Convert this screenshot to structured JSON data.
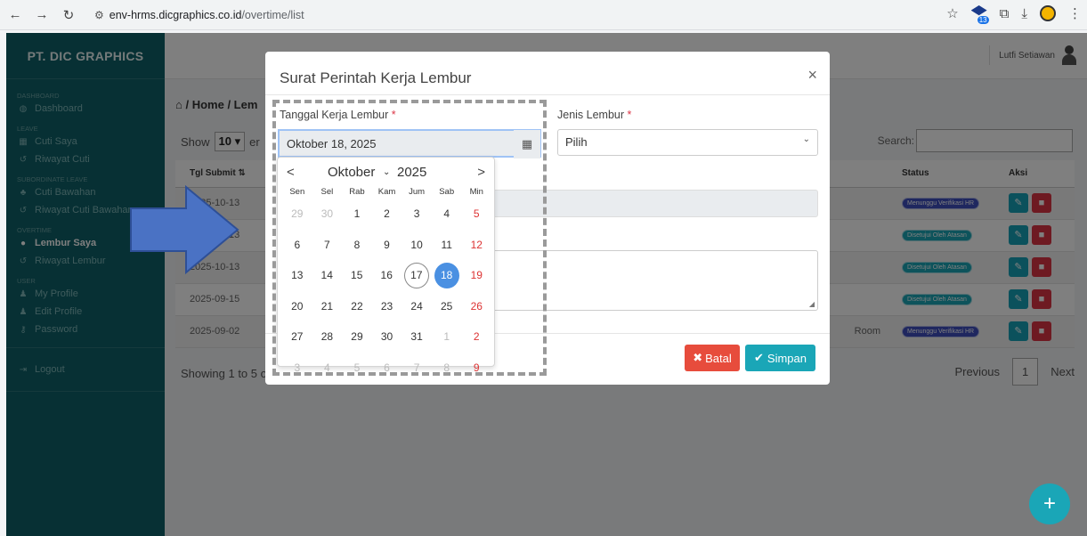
{
  "browser": {
    "url_domain": "env-hrms.dicgraphics.co.id",
    "url_path": "/overtime/list",
    "ext_badge_count": "13"
  },
  "sidebar": {
    "title": "PT. DIC GRAPHICS",
    "sections": {
      "dashboard": "DASHBOARD",
      "leave": "LEAVE",
      "subordinate": "SUBORDINATE LEAVE",
      "overtime": "OVERTIME",
      "user": "USER"
    },
    "items": {
      "dashboard": "Dashboard",
      "cuti_saya": "Cuti Saya",
      "riwayat_cuti": "Riwayat Cuti",
      "cuti_bawahan": "Cuti Bawahan",
      "riwayat_cuti_bawahan": "Riwayat Cuti Bawahan",
      "lembur_saya": "Lembur Saya",
      "riwayat_lembur": "Riwayat Lembur",
      "my_profile": "My Profile",
      "edit_profile": "Edit Profile",
      "password": "Password",
      "logout": "Logout"
    }
  },
  "header": {
    "user_name": "Lutfi Setiawan"
  },
  "page": {
    "breadcrumb": "/ Home / Lem",
    "show_label": "Show",
    "show_value": "10",
    "entries_frag": "er",
    "search_label": "Search:",
    "table": {
      "headers": {
        "tgl_submit": "Tgl Submit",
        "status": "Status",
        "aksi": "Aksi"
      },
      "rows": [
        {
          "date": "2025-10-13",
          "extra": "",
          "status": "Menunggu Verifikasi HR"
        },
        {
          "date": "2025-10-13",
          "extra": "",
          "status": "Disetujui Oleh Atasan"
        },
        {
          "date": "2025-10-13",
          "extra": "",
          "status": "Disetujui Oleh Atasan"
        },
        {
          "date": "2025-09-15",
          "extra": "",
          "status": "Disetujui Oleh Atasan"
        },
        {
          "date": "2025-09-02",
          "extra": "Room",
          "status": "Menunggu Verifikasi HR"
        }
      ]
    },
    "showing": "Showing 1 to 5 o",
    "pager": {
      "prev": "Previous",
      "current": "1",
      "next": "Next"
    },
    "fab_label": "+"
  },
  "modal": {
    "title": "Surat Perintah Kerja Lembur",
    "close": "×",
    "date_label": "Tanggal Kerja Lembur",
    "date_value": "Oktober 18, 2025",
    "type_label": "Jenis Lembur",
    "type_value": "Pilih",
    "required_mark": "*",
    "cancel_label": "Batal",
    "save_label": "Simpan"
  },
  "datepicker": {
    "month": "Oktober",
    "year": "2025",
    "prev": "<",
    "next": ">",
    "days_of_week": [
      "Sen",
      "Sel",
      "Rab",
      "Kam",
      "Jum",
      "Sab",
      "Min"
    ],
    "weeks": [
      [
        "29",
        "30",
        "1",
        "2",
        "3",
        "4",
        "5"
      ],
      [
        "6",
        "7",
        "8",
        "9",
        "10",
        "11",
        "12"
      ],
      [
        "13",
        "14",
        "15",
        "16",
        "17",
        "18",
        "19"
      ],
      [
        "20",
        "21",
        "22",
        "23",
        "24",
        "25",
        "26"
      ],
      [
        "27",
        "28",
        "29",
        "30",
        "31",
        "1",
        "2"
      ],
      [
        "3",
        "4",
        "5",
        "6",
        "7",
        "8",
        "9"
      ]
    ],
    "today": "17",
    "selected": "18"
  },
  "colors": {
    "sidebar": "#0f6168",
    "teal": "#1aa6b7",
    "red": "#e74c3c",
    "selected_day": "#4a90e2",
    "arrow": "#4a72c4"
  },
  "icons": {
    "back": "back-arrow-icon",
    "forward": "forward-arrow-icon",
    "reload": "reload-icon",
    "calendar": "calendar-icon",
    "close": "close-icon",
    "home": "home-icon",
    "edit": "edit-icon",
    "delete": "trash-icon"
  }
}
